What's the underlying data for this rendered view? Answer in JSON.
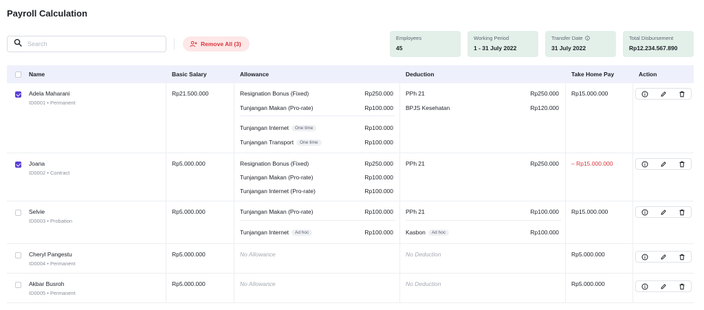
{
  "page": {
    "title": "Payroll Calculation"
  },
  "search": {
    "placeholder": "Search",
    "value": ""
  },
  "toolbar": {
    "remove_all_label": "Remove All (3)"
  },
  "stats": [
    {
      "label": "Employees",
      "value": "45"
    },
    {
      "label": "Working Period",
      "value": "1 - 31 July 2022"
    },
    {
      "label": "Transfer Date",
      "value": "31 July 2022"
    },
    {
      "label": "Total Disbursement",
      "value": "Rp12.234.567.890"
    }
  ],
  "table": {
    "columns": [
      "Name",
      "Basic Salary",
      "Allowance",
      "Deduction",
      "Take Home Pay",
      "Action"
    ],
    "empty_allowance": "No Allowance",
    "empty_deduction": "No Deduction",
    "rows": [
      {
        "checked": true,
        "name": "Adela Maharani",
        "meta": "ID0001 • Permanent",
        "basic_salary": "Rp21.500.000",
        "allowances": [
          {
            "label": "Resignation Bonus (Fixed)",
            "amount": "Rp250.000"
          },
          {
            "label": "Tunjangan Makan (Pro-rate)",
            "amount": "Rp100.000"
          },
          {
            "label": "Tunjangan Internet",
            "badge": "One time",
            "amount": "Rp100.000"
          },
          {
            "label": "Tunjangan Transport",
            "badge": "One time",
            "amount": "Rp100.000"
          }
        ],
        "deductions": [
          {
            "label": "PPh 21",
            "amount": "Rp250.000"
          },
          {
            "label": "BPJS Kesehatan",
            "amount": "Rp120.000"
          }
        ],
        "take_home_pay": "Rp15.000.000"
      },
      {
        "checked": true,
        "name": "Joana",
        "meta": "ID0002 • Contract",
        "basic_salary": "Rp5.000.000",
        "allowances": [
          {
            "label": "Resignation Bonus (Fixed)",
            "amount": "Rp250.000"
          },
          {
            "label": "Tunjangan Makan (Pro-rate)",
            "amount": "Rp100.000"
          },
          {
            "label": "Tunjangan Internet (Pro-rate)",
            "amount": "Rp100.000"
          }
        ],
        "deductions": [
          {
            "label": "PPh 21",
            "amount": "Rp250.000"
          }
        ],
        "take_home_pay": "– Rp15.000.000"
      },
      {
        "checked": false,
        "name": "Selvie",
        "meta": "ID0003 • Probation",
        "basic_salary": "Rp5.000.000",
        "allowances": [
          {
            "label": "Tunjangan Makan (Pro-rate)",
            "amount": "Rp100.000"
          },
          {
            "label": "Tunjangan Internet",
            "badge": "Ad hoc",
            "amount": "Rp100.000"
          }
        ],
        "deductions": [
          {
            "label": "PPh 21",
            "amount": "Rp100.000"
          },
          {
            "label": "Kasbon",
            "badge": "Ad hoc",
            "amount": "Rp100.000"
          }
        ],
        "take_home_pay": "Rp15.000.000"
      },
      {
        "checked": false,
        "name": "Cheryl Pangestu",
        "meta": "ID0004 • Permanent",
        "basic_salary": "Rp5.000.000",
        "take_home_pay": "Rp5.000.000"
      },
      {
        "checked": false,
        "name": "Akbar Busroh",
        "meta": "ID0005 • Permanent",
        "basic_salary": "Rp5.000.000",
        "take_home_pay": "Rp5.000.000"
      }
    ]
  },
  "colors": {
    "accent": "#5b3fd6",
    "danger": "#d9363e",
    "stat_bg": "#e3efe9",
    "header_bg": "#eef0fb"
  }
}
